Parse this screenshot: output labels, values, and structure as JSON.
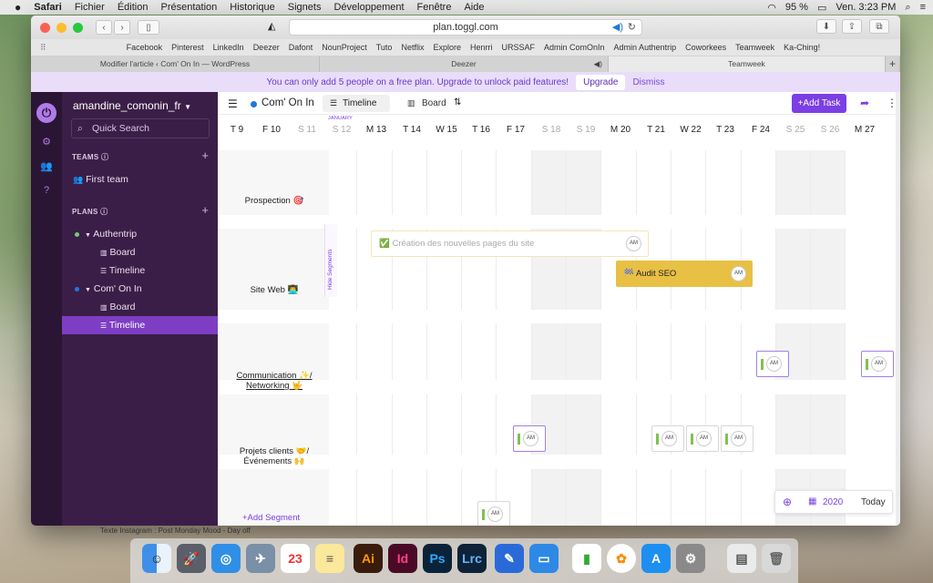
{
  "menubar": {
    "app": "Safari",
    "items": [
      "Fichier",
      "Édition",
      "Présentation",
      "Historique",
      "Signets",
      "Développement",
      "Fenêtre",
      "Aide"
    ],
    "battery": "95 %",
    "clock": "Ven. 3:23 PM"
  },
  "browser": {
    "url": "plan.toggl.com",
    "favorites": [
      "Facebook",
      "Pinterest",
      "LinkedIn",
      "Deezer",
      "Dafont",
      "NounProject",
      "Tuto",
      "Netflix",
      "Explore",
      "Henrri",
      "URSSAF",
      "Admin ComOnIn",
      "Admin Authentrip",
      "Coworkees",
      "Teamweek",
      "Ka-Ching!"
    ],
    "tabs": [
      "Modifier l'article ‹ Com' On In — WordPress",
      "Deezer",
      "Teamweek"
    ]
  },
  "banner": {
    "text": "You can only add 5 people on a free plan. Upgrade to unlock paid features!",
    "upgrade": "Upgrade",
    "dismiss": "Dismiss"
  },
  "sidebar": {
    "user": "amandine_comonin_fr",
    "search_placeholder": "Quick Search",
    "teams_label": "TEAMS",
    "team": "First team",
    "plans_label": "PLANS",
    "plans": [
      {
        "name": "Authentrip",
        "color": "#6dd16a",
        "views": [
          "Board",
          "Timeline"
        ]
      },
      {
        "name": "Com' On In",
        "color": "#1d7ad6",
        "views": [
          "Board",
          "Timeline"
        ]
      }
    ]
  },
  "header": {
    "project": "Com' On In",
    "tab_timeline": "Timeline",
    "tab_board": "Board",
    "add_task": "+Add Task",
    "month": "JANUARY"
  },
  "dates": [
    {
      "label": "T 9",
      "weekend": false
    },
    {
      "label": "F 10",
      "weekend": false
    },
    {
      "label": "S 11",
      "weekend": true
    },
    {
      "label": "S 12",
      "weekend": true
    },
    {
      "label": "M 13",
      "weekend": false
    },
    {
      "label": "T 14",
      "weekend": false
    },
    {
      "label": "W 15",
      "weekend": false
    },
    {
      "label": "T 16",
      "weekend": false
    },
    {
      "label": "F 17",
      "weekend": false
    },
    {
      "label": "S 18",
      "weekend": true
    },
    {
      "label": "S 19",
      "weekend": true
    },
    {
      "label": "M 20",
      "weekend": false
    },
    {
      "label": "T 21",
      "weekend": false
    },
    {
      "label": "W 22",
      "weekend": false
    },
    {
      "label": "T 23",
      "weekend": false
    },
    {
      "label": "F 24",
      "weekend": false
    },
    {
      "label": "S 25",
      "weekend": true
    },
    {
      "label": "S 26",
      "weekend": true
    },
    {
      "label": "M 27",
      "weekend": false
    }
  ],
  "segments": [
    "Prospection 🎯",
    "Site Web 👨‍💻",
    "Communication ✨/ Networking 🤟",
    "Projets clients 🤝/ Événements 🙌"
  ],
  "hide_segments": "Hide Segments",
  "add_segment": "+Add Segment",
  "tasks": {
    "creation": "✅ Création des nouvelles pages du site",
    "audit": "🏁 Audit SEO",
    "avatar": "AM",
    "audit_color": "#e8c044"
  },
  "footer": {
    "year": "2020",
    "today": "Today",
    "below": "Texte        Instagram : Post Monday Mood - Day off"
  }
}
